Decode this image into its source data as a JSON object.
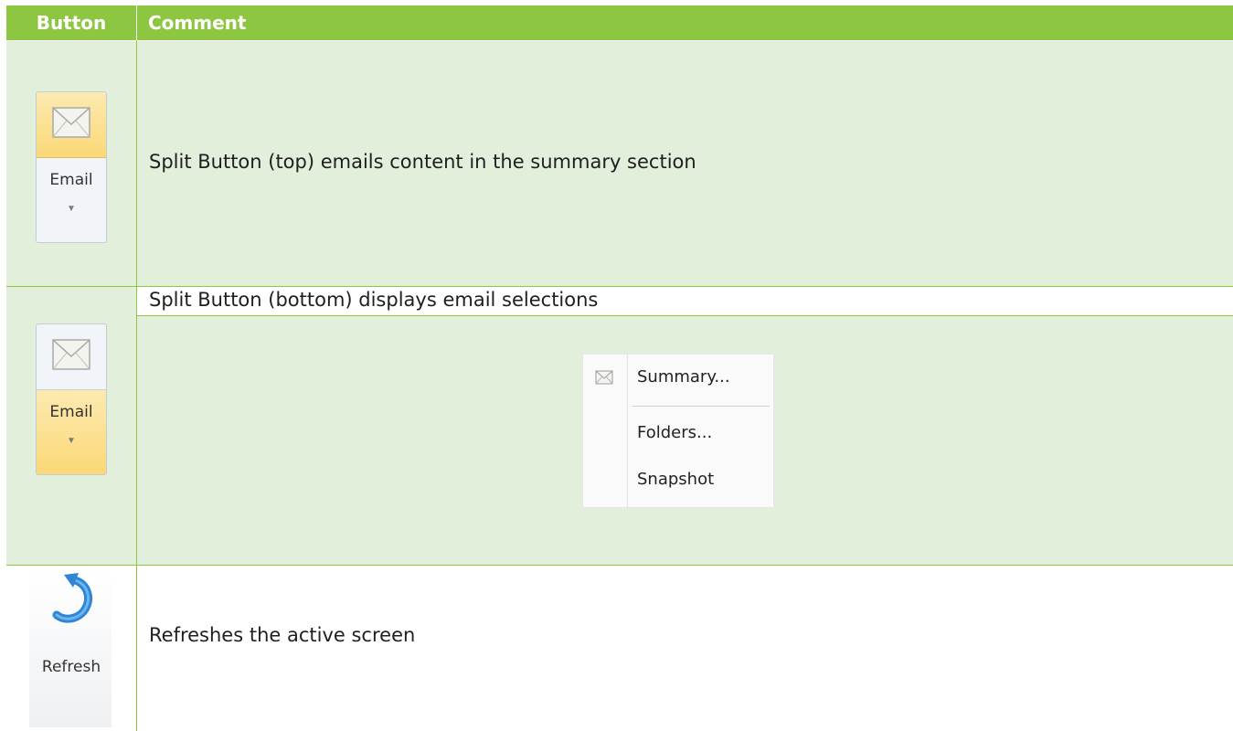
{
  "table": {
    "headers": {
      "button": "Button",
      "comment": "Comment"
    },
    "rows": [
      {
        "button_label": "Email",
        "button_icon": "envelope-icon",
        "highlight": "top",
        "comment": "Split Button (top) emails content in the summary section"
      },
      {
        "button_label": "Email",
        "button_icon": "envelope-icon",
        "highlight": "bottom",
        "comment": "Split Button (bottom) displays email selections",
        "menu": {
          "items": [
            {
              "label": "Summary...",
              "icon": "envelope-icon"
            },
            {
              "label": "Folders..."
            },
            {
              "label": "Snapshot"
            }
          ]
        }
      },
      {
        "button_label": "Refresh",
        "button_icon": "refresh-icon",
        "comment": "Refreshes the active screen"
      }
    ]
  },
  "colors": {
    "header_bg": "#8dc640",
    "header_text": "#ffffff",
    "band_bg": "#e2efda",
    "highlight": "#fbd877"
  }
}
